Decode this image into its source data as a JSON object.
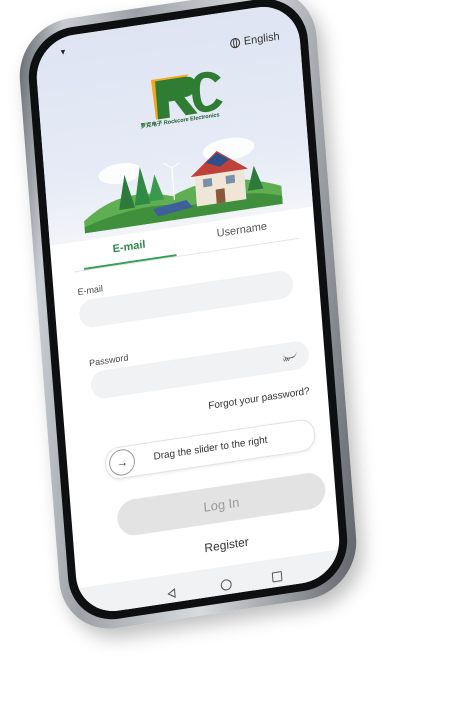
{
  "status": {
    "caret": "▾"
  },
  "header": {
    "language": "English",
    "logo_letters": "RC",
    "logo_caption": "罗克电子 Rockcore Electronics"
  },
  "tabs": [
    {
      "label": "E-mail",
      "active": true
    },
    {
      "label": "Username",
      "active": false
    }
  ],
  "form": {
    "email_label": "E-mail",
    "email_value": "",
    "password_label": "Password",
    "password_value": "",
    "forgot_label": "Forgot your password?"
  },
  "slider": {
    "arrow": "→",
    "text": "Drag the slider to the right",
    "progress": 0
  },
  "actions": {
    "login_label": "Log In",
    "register_label": "Register"
  },
  "colors": {
    "accent": "#34a054",
    "logo_green": "#2e7d32",
    "logo_orange": "#f5a623",
    "disabled_button": "#e3e3e3"
  },
  "icons": [
    "globe-icon",
    "eye-closed-icon",
    "arrow-right-icon",
    "back-icon",
    "home-icon",
    "recent-apps-icon"
  ]
}
